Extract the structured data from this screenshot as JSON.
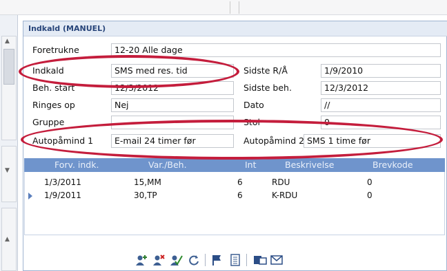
{
  "panel": {
    "title": "Indkald (MANUEL)"
  },
  "form": {
    "foretrukne": {
      "label": "Foretrukne",
      "value": "12-20 Alle dage"
    },
    "indkald": {
      "label": "Indkald",
      "value": "SMS med res. tid"
    },
    "sidste_rv": {
      "label": "Sidste R/Å",
      "value": "1/9/2010"
    },
    "beh_start": {
      "label": "Beh. start",
      "value": "12/3/2012"
    },
    "sidste_beh": {
      "label": "Sidste beh.",
      "value": "12/3/2012"
    },
    "ringes_op": {
      "label": "Ringes op",
      "value": "Nej"
    },
    "dato": {
      "label": "Dato",
      "value": "//"
    },
    "gruppe": {
      "label": "Gruppe",
      "value": ""
    },
    "stol": {
      "label": "Stol",
      "value": "0"
    },
    "autopaamind1": {
      "label": "Autopåmind 1",
      "value": "E-mail 24 timer før"
    },
    "autopaamind2": {
      "label": "Autopåmind 2",
      "value": "SMS 1 time før"
    }
  },
  "table": {
    "headers": [
      "Forv. indk.",
      "Var./Beh.",
      "Int",
      "Beskrivelse",
      "Brevkode"
    ],
    "rows": [
      [
        "1/3/2011",
        "15,MM",
        "6",
        "RDU",
        "0"
      ],
      [
        "1/9/2011",
        "30,TP",
        "6",
        "K-RDU",
        "0"
      ]
    ]
  },
  "toolbar": {
    "icons": [
      "add-person-icon",
      "remove-person-icon",
      "approve-person-icon",
      "refresh-icon",
      "flag-icon",
      "document-icon",
      "sms-icon",
      "email-icon"
    ]
  },
  "colors": {
    "annotation": "#c41d3c",
    "table_header": "#6f94cc",
    "title_text": "#28457a"
  }
}
